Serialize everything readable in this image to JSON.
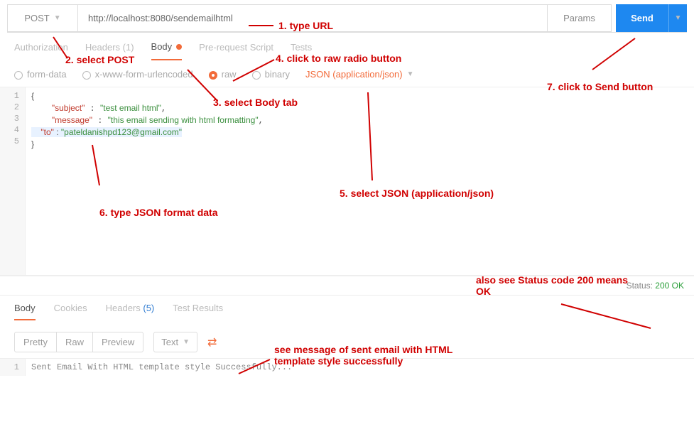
{
  "top": {
    "method": "POST",
    "url": "http://localhost:8080/sendemailhtml",
    "params": "Params",
    "send": "Send"
  },
  "tabs": {
    "auth": "Authorization",
    "headers": "Headers (1)",
    "body": "Body",
    "prereq": "Pre-request Script",
    "tests": "Tests"
  },
  "bodyTypes": {
    "formdata": "form-data",
    "xwww": "x-www-form-urlencoded",
    "raw": "raw",
    "binary": "binary",
    "json": "JSON (application/json)"
  },
  "code": {
    "l1": "{",
    "k2": "\"subject\"",
    "v2": "\"test email html\"",
    "k3": "\"message\"",
    "v3": "\"this email sending with html formatting\"",
    "k4": "\"to\"",
    "v4": "\"pateldanishpd123@gmail.com\"",
    "l5": "}"
  },
  "status": {
    "label": "Status:",
    "value": "200 OK"
  },
  "respTabs": {
    "body": "Body",
    "cookies": "Cookies",
    "headers": "Headers",
    "hcount": "(5)",
    "tests": "Test Results"
  },
  "respBar": {
    "pretty": "Pretty",
    "raw": "Raw",
    "preview": "Preview",
    "text": "Text"
  },
  "respText": "Sent Email With HTML template style Successfully...",
  "ann": {
    "a1": "1. type URL",
    "a2": "2. select POST",
    "a3": "3. select Body tab",
    "a4": "4. click to raw radio button",
    "a5": "5. select JSON (application/json)",
    "a6": "6. type JSON format data",
    "a7": "7. click to Send button",
    "a8": "also see Status code 200 means OK",
    "a9": "see message of sent email with HTML template style successfully"
  }
}
